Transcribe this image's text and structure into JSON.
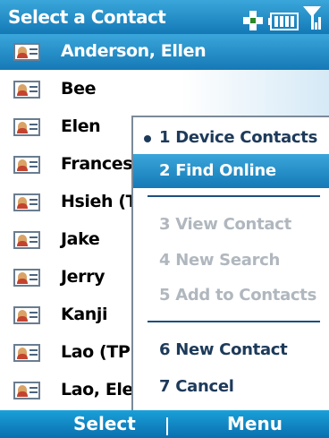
{
  "header": {
    "title": "Select a Contact"
  },
  "status_icons": [
    "sync-icon",
    "battery-icon",
    "signal-icon"
  ],
  "contacts": [
    {
      "name": "Anderson, Ellen",
      "selected": true
    },
    {
      "name": "Bee",
      "selected": false
    },
    {
      "name": "Elen",
      "selected": false
    },
    {
      "name": "Frances",
      "selected": false
    },
    {
      "name": "Hsieh (T",
      "selected": false
    },
    {
      "name": "Jake",
      "selected": false
    },
    {
      "name": "Jerry",
      "selected": false
    },
    {
      "name": "Kanji",
      "selected": false
    },
    {
      "name": "Lao (TPI",
      "selected": false
    },
    {
      "name": "Lao, Ele",
      "selected": false
    }
  ],
  "menu": {
    "items": [
      {
        "label": "1 Device Contacts",
        "checked": true,
        "enabled": true
      },
      {
        "label": "2 Find Online",
        "selected": true,
        "enabled": true
      },
      {
        "label": "3 View Contact",
        "enabled": false
      },
      {
        "label": "4 New Search",
        "enabled": false
      },
      {
        "label": "5 Add to Contacts",
        "enabled": false
      },
      {
        "label": "6 New Contact",
        "enabled": true
      },
      {
        "label": "7 Cancel",
        "enabled": true
      }
    ]
  },
  "softkeys": {
    "left": "Select",
    "right": "Menu"
  },
  "colors": {
    "accent": "#1a8ccf",
    "menu_text": "#1d3a5a",
    "disabled_text": "#b0b7be"
  }
}
